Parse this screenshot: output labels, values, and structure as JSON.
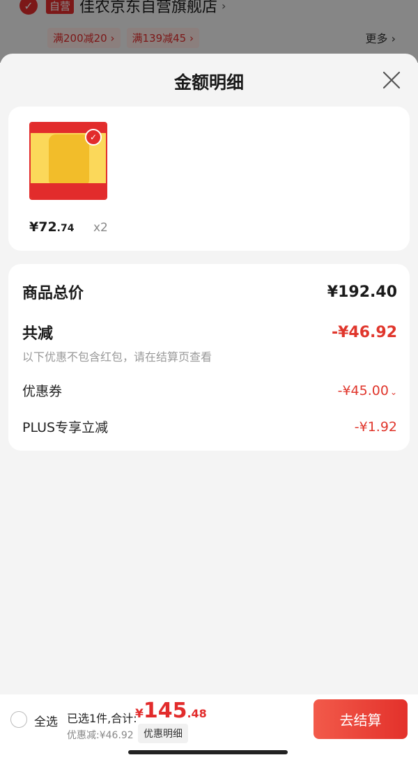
{
  "background": {
    "shop_tag": "自营",
    "shop_name": "佳农京东自营旗舰店",
    "promos": [
      "满200减20",
      "满139减45"
    ],
    "more_label": "更多"
  },
  "sheet": {
    "title": "金额明细",
    "product": {
      "price_int": "¥72",
      "price_dec": ".74",
      "quantity": "x2"
    },
    "summary": {
      "total_label": "商品总价",
      "total_value": "¥192.40",
      "reduce_label": "共减",
      "reduce_value": "-¥46.92",
      "note": "以下优惠不包含红包，请在结算页查看",
      "coupon_label": "优惠券",
      "coupon_value": "-¥45.00",
      "plus_label": "PLUS专享立减",
      "plus_value": "-¥1.92"
    }
  },
  "bottom_bar": {
    "select_all": "全选",
    "selected_text": "已选1件,合计:",
    "total_yen": "¥",
    "total_int": "145",
    "total_dec": ".48",
    "discount_text": "优惠减:¥46.92",
    "discount_detail": "优惠明细",
    "checkout": "去结算"
  },
  "colors": {
    "accent": "#e22c2c",
    "discount": "#e0362c"
  }
}
